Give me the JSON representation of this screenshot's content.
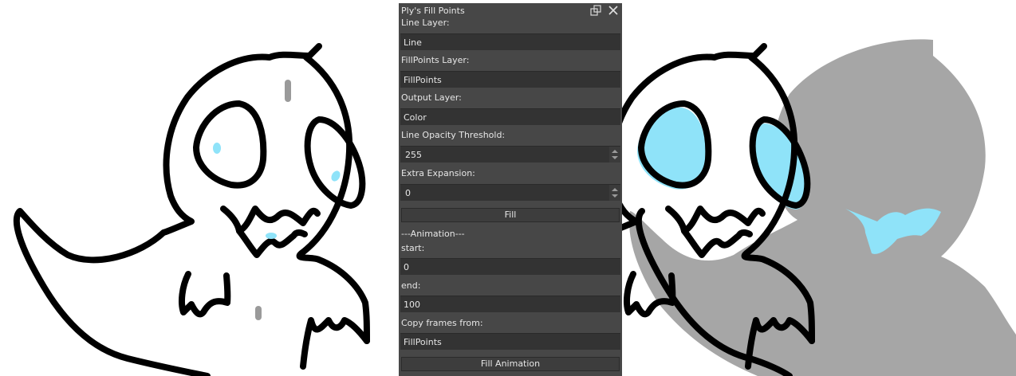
{
  "panel": {
    "title": "Ply's Fill Points",
    "line_layer_label": "Line Layer:",
    "line_layer_value": "Line",
    "fillpoints_layer_label": "FillPoints Layer:",
    "fillpoints_layer_value": "FillPoints",
    "output_layer_label": "Output Layer:",
    "output_layer_value": "Color",
    "threshold_label": "Line Opacity Threshold:",
    "threshold_value": "255",
    "expansion_label": "Extra Expansion:",
    "expansion_value": "0",
    "fill_button": "Fill",
    "animation_header": "---Animation---",
    "start_label": "start:",
    "start_value": "0",
    "end_label": "end:",
    "end_value": "100",
    "copy_frames_label": "Copy frames from:",
    "copy_frames_value": "FillPoints",
    "fill_animation_button": "Fill Animation"
  },
  "colors": {
    "panel_bg": "#474747",
    "field_bg": "#333333",
    "line_art": "#000000",
    "ghost_fill": "#a6a6a6",
    "eye_fill": "#8fe3f9",
    "fill_point_grey": "#9a9a9a",
    "fill_point_blue": "#8fe3f9"
  },
  "icons": {
    "float": "float-window-icon",
    "close": "close-icon"
  }
}
